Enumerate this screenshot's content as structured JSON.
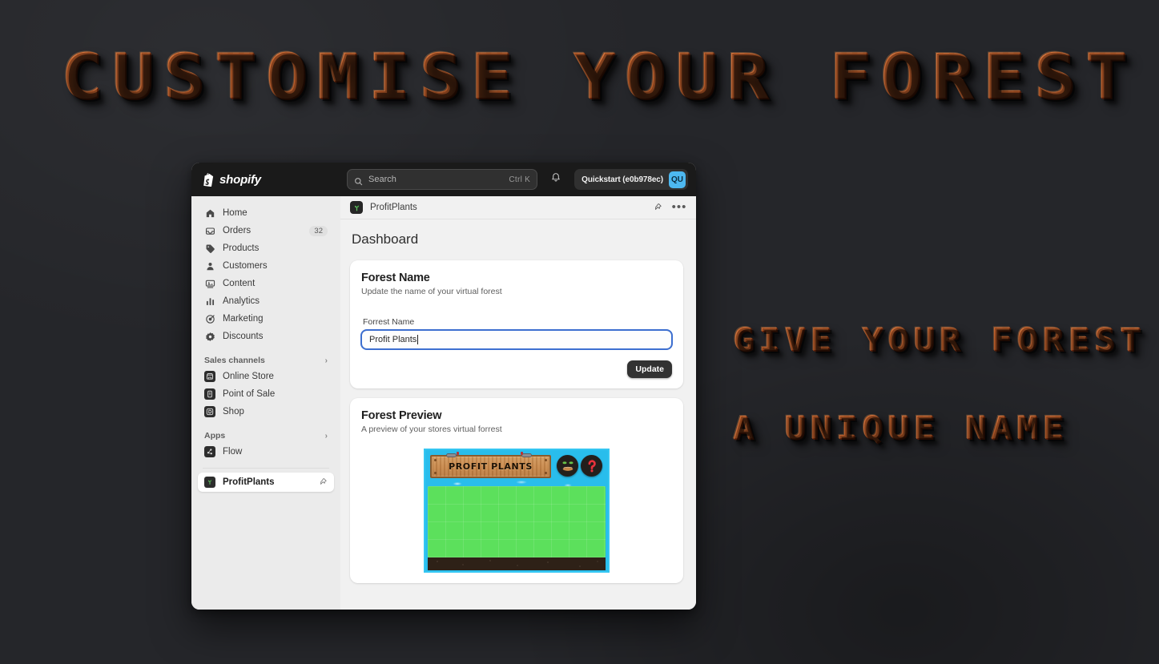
{
  "overlay": {
    "title": "CUSTOMISE YOUR FOREST",
    "tagline_line1": "GIVE YOUR FOREST",
    "tagline_line2": "A UNIQUE NAME",
    "accent_color": "#c8571f",
    "background_color": "#25262a"
  },
  "topbar": {
    "logo_icon": "shopify-bag-icon",
    "logo_text": "shopify",
    "search": {
      "icon": "search-icon",
      "placeholder": "Search",
      "shortcut": "Ctrl K"
    },
    "notifications_icon": "bell-icon",
    "account": {
      "name": "Quickstart (e0b978ec)",
      "avatar_initials": "QU",
      "avatar_color": "#4db8f0"
    }
  },
  "sidebar": {
    "items": [
      {
        "label": "Home",
        "icon": "home-icon",
        "badge": ""
      },
      {
        "label": "Orders",
        "icon": "orders-icon",
        "badge": "32"
      },
      {
        "label": "Products",
        "icon": "products-icon",
        "badge": ""
      },
      {
        "label": "Customers",
        "icon": "customers-icon",
        "badge": ""
      },
      {
        "label": "Content",
        "icon": "content-icon",
        "badge": ""
      },
      {
        "label": "Analytics",
        "icon": "analytics-icon",
        "badge": ""
      },
      {
        "label": "Marketing",
        "icon": "marketing-icon",
        "badge": ""
      },
      {
        "label": "Discounts",
        "icon": "discounts-icon",
        "badge": ""
      }
    ],
    "sales_channels": {
      "title": "Sales channels",
      "chevron": "›",
      "items": [
        {
          "label": "Online Store",
          "icon": "online-store-icon"
        },
        {
          "label": "Point of Sale",
          "icon": "point-of-sale-icon"
        },
        {
          "label": "Shop",
          "icon": "shop-icon"
        }
      ]
    },
    "apps": {
      "title": "Apps",
      "chevron": "›",
      "items": [
        {
          "label": "Flow",
          "icon": "flow-icon"
        }
      ]
    },
    "active_app": {
      "label": "ProfitPlants",
      "icon": "profitplants-icon",
      "pin_icon": "pin-icon"
    }
  },
  "app_bar": {
    "icon": "profitplants-icon",
    "title": "ProfitPlants",
    "pin_icon": "pin-icon",
    "more_icon": "more-horizontal-icon",
    "more_glyph": "•••"
  },
  "main": {
    "page_title": "Dashboard",
    "forest_name_card": {
      "title": "Forest Name",
      "subtitle": "Update the name of your virtual forest",
      "field_label": "Forrest Name",
      "field_value": "Profit Plants",
      "field_placeholder": "Forrest Name",
      "submit_label": "Update",
      "focus_color": "#3d6fd0"
    },
    "forest_preview_card": {
      "title": "Forest Preview",
      "subtitle": "A preview of your stores virtual forrest",
      "sign_text": "PROFIT PLANTS",
      "badges": [
        {
          "icon": "seedling-badge-icon"
        },
        {
          "icon": "question-mark-badge-icon"
        }
      ],
      "sky_color": "#29bdec",
      "grass_color": "#5ce05c",
      "dirt_color": "#2e2117"
    }
  }
}
